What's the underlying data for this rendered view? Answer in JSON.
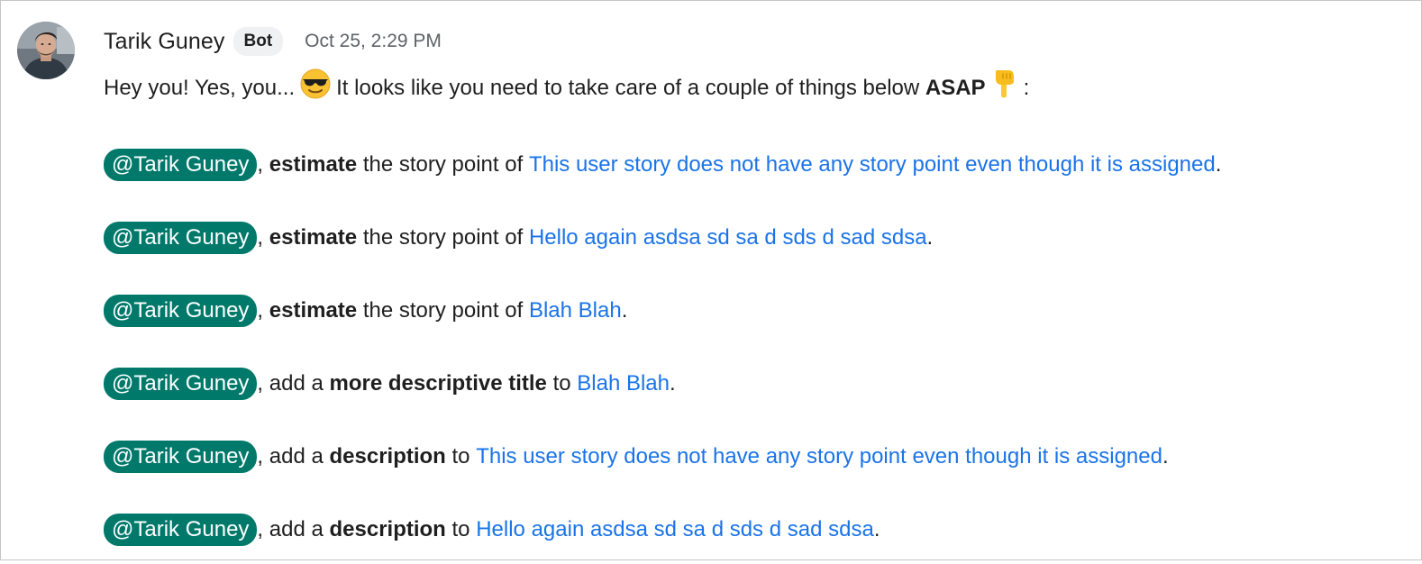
{
  "sender": {
    "name": "Tarik Guney",
    "badge": "Bot",
    "timestamp": "Oct 25, 2:29 PM",
    "avatar_icon": "user-photo-avatar"
  },
  "intro": {
    "text_before": "Hey you! Yes, you...",
    "emoji_1": "smiling-face-with-sunglasses-icon",
    "text_middle": "It looks like you need to take care of a couple of things below",
    "bold": "ASAP",
    "emoji_2": "backhand-index-pointing-down-icon",
    "text_after": ":"
  },
  "colors": {
    "mention_bg": "#00796b",
    "link": "#1a73e8",
    "badge_bg": "#f0f1f3"
  },
  "tasks": [
    {
      "mention": "@Tarik Guney",
      "prefix": ", ",
      "action": "estimate",
      "middle": " the story point of ",
      "link": "This user story does not have any story point even though it is assigned",
      "suffix": "."
    },
    {
      "mention": "@Tarik Guney",
      "prefix": ", ",
      "action": "estimate",
      "middle": " the story point of ",
      "link": "Hello again asdsa sd sa d sds d sad sdsa",
      "suffix": "."
    },
    {
      "mention": "@Tarik Guney",
      "prefix": ", ",
      "action": "estimate",
      "middle": " the story point of ",
      "link": "Blah Blah",
      "suffix": "."
    },
    {
      "mention": "@Tarik Guney",
      "prefix": ", add a ",
      "action": "more descriptive title",
      "middle": " to ",
      "link": "Blah Blah",
      "suffix": "."
    },
    {
      "mention": "@Tarik Guney",
      "prefix": ", add a ",
      "action": "description",
      "middle": " to ",
      "link": "This user story does not have any story point even though it is assigned",
      "suffix": "."
    },
    {
      "mention": "@Tarik Guney",
      "prefix": ", add a ",
      "action": "description",
      "middle": " to ",
      "link": "Hello again asdsa sd sa d sds d sad sdsa",
      "suffix": "."
    }
  ]
}
